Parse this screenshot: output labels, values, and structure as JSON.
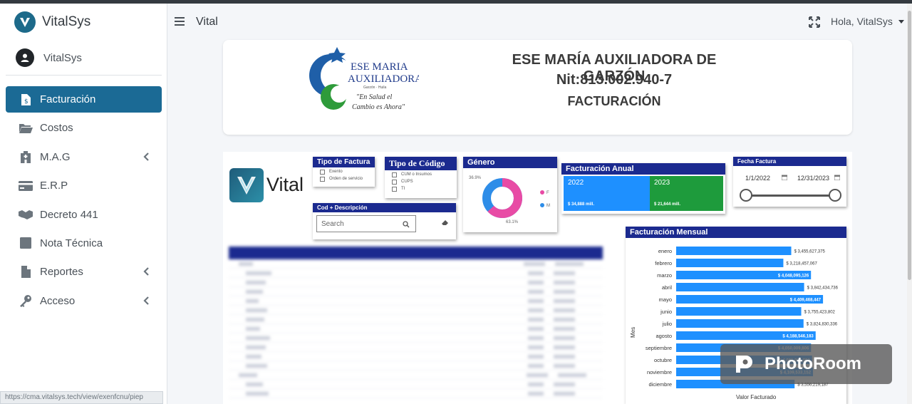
{
  "sidebar": {
    "brand": "VitalSys",
    "user": "VitalSys",
    "items": [
      {
        "label": "Facturación",
        "icon": "invoice-icon",
        "active": true,
        "chevron": false
      },
      {
        "label": "Costos",
        "icon": "folder-open-icon",
        "active": false,
        "chevron": false
      },
      {
        "label": "M.A.G",
        "icon": "hospital-icon",
        "active": false,
        "chevron": true
      },
      {
        "label": "E.R.P",
        "icon": "credit-card-icon",
        "active": false,
        "chevron": false
      },
      {
        "label": "Decreto 441",
        "icon": "handshake-icon",
        "active": false,
        "chevron": false
      },
      {
        "label": "Nota Técnica",
        "icon": "square-icon",
        "active": false,
        "chevron": false
      },
      {
        "label": "Reportes",
        "icon": "file-icon",
        "active": false,
        "chevron": true
      },
      {
        "label": "Acceso",
        "icon": "key-icon",
        "active": false,
        "chevron": true
      }
    ],
    "status_url": "https://cma.vitalsys.tech/view/exenfcnu/piep"
  },
  "header": {
    "title": "Vital",
    "user_greeting": "Hola, VitalSys"
  },
  "org": {
    "logo_title_line1": "ESE MARIA",
    "logo_title_line2": "AUXILIADORA",
    "logo_place": "Garzón · Huila",
    "logo_slogan_line1": "\"En Salud el",
    "logo_slogan_line2": "Cambio es Ahora\"",
    "name": "ESE MARÍA AUXILIADORA DE GARZÓN",
    "nit": "Nit:813.002.940-7",
    "section": "FACTURACIÓN"
  },
  "report": {
    "logo_text": "Vital",
    "tipo_factura": {
      "title": "Tipo de Factura",
      "options": [
        "Exento",
        "Orden de servicio"
      ]
    },
    "tipo_codigo": {
      "title": "Tipo de Código",
      "options": [
        "CUM o Insumos",
        "CUPS",
        "TI"
      ]
    },
    "genero": {
      "title": "Género",
      "label_left": "36.9%",
      "label_bottom": "63.1%",
      "legend": [
        "F",
        "M"
      ],
      "colors": [
        "#e84ba5",
        "#2e8de8"
      ]
    },
    "facturacion_anual": {
      "title": "Facturación Anual",
      "years": [
        "2022",
        "2023"
      ],
      "values": [
        "$ 34,888 mill.",
        "$ 21,644 mill."
      ]
    },
    "fecha": {
      "title": "Fecha Factura",
      "start": "1/1/2022",
      "end": "12/31/2023"
    },
    "cod_desc": {
      "title": "Cod + Descripción",
      "placeholder": "Search"
    },
    "mensual": {
      "title": "Facturación Mensual",
      "y_axis": "Mes",
      "x_axis": "Valor Facturado"
    }
  },
  "chart_data": {
    "type": "bar",
    "orientation": "horizontal",
    "title": "Facturación Mensual",
    "ylabel": "Mes",
    "xlabel": "Valor Facturado",
    "categories": [
      "enero",
      "febrero",
      "marzo",
      "abril",
      "mayo",
      "junio",
      "julio",
      "agosto",
      "septiembre",
      "octubre",
      "noviembre",
      "diciembre"
    ],
    "values": [
      3455627375,
      3218457067,
      4048095126,
      3842434736,
      4409468447,
      3755423802,
      3824830336,
      4188546183,
      4050009806,
      4081001003,
      4109533152,
      3556219187
    ],
    "value_labels": [
      "$ 3,455,627,375",
      "$ 3,218,457,067",
      "$ 4,048,095,126",
      "$ 3,842,434,736",
      "$ 4,409,468,447",
      "$ 3,755,423,802",
      "$ 3,824,830,336",
      "$ 4,188,546,183",
      "$ 4,050,009,806",
      "$ 4,081,001,003",
      "$ 4,109,533,152",
      "$ 3,556,219,187"
    ],
    "label_inside": [
      false,
      false,
      true,
      false,
      true,
      false,
      false,
      true,
      true,
      true,
      true,
      false
    ],
    "xlim": [
      0,
      4600000000
    ],
    "color": "#1e90ff"
  },
  "watermark": {
    "text": "PhotoRoom"
  }
}
